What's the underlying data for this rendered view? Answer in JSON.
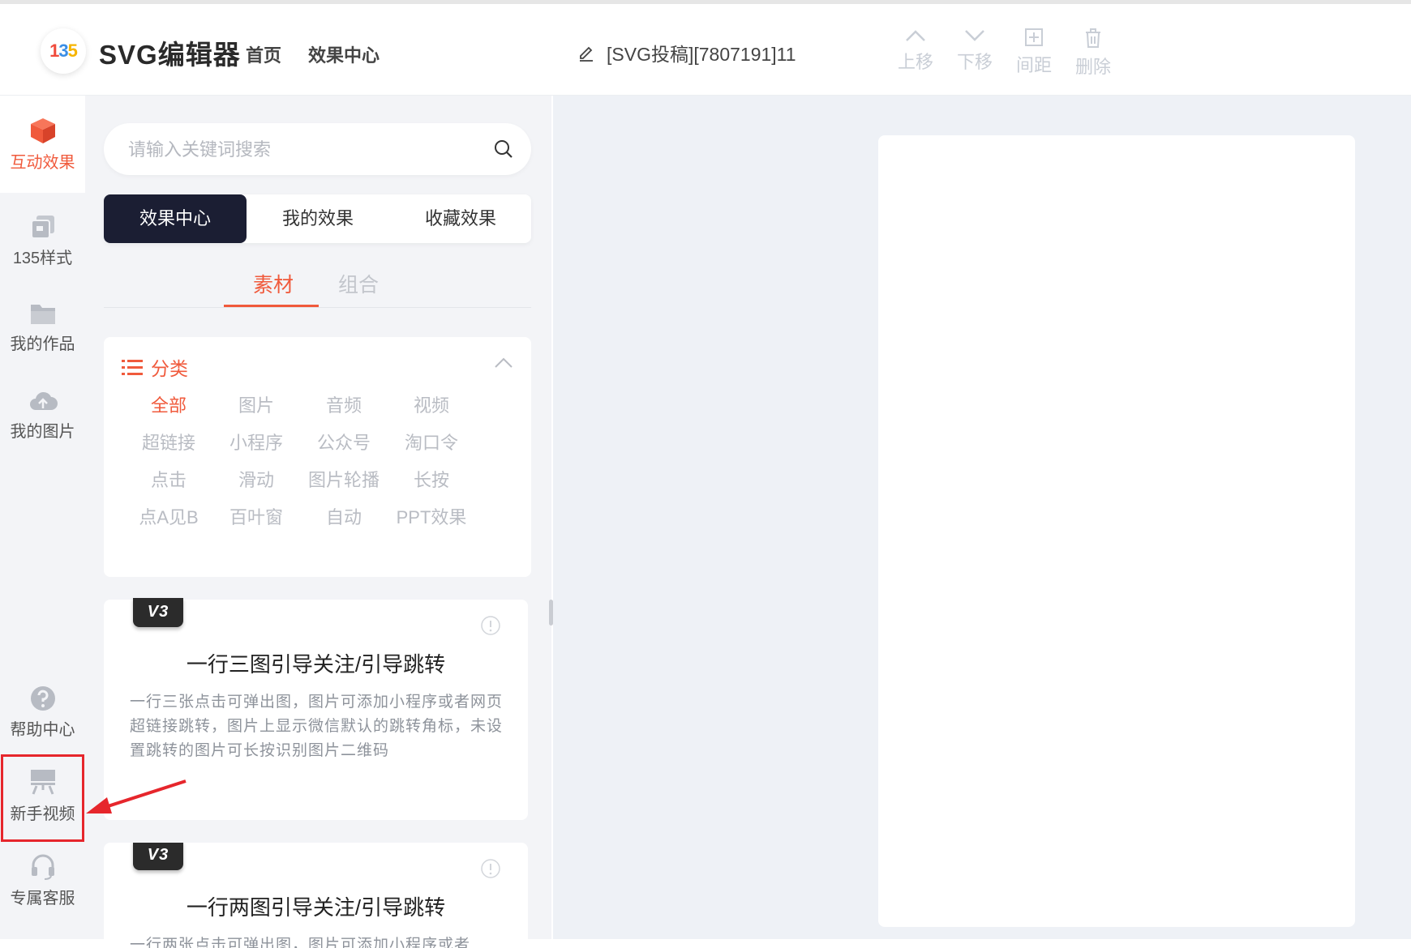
{
  "header": {
    "logo_text": "135",
    "app_name": "SVG编辑器",
    "nav": [
      "首页",
      "效果中心"
    ],
    "doc_title": "[SVG投稿][7807191]11",
    "tools": [
      {
        "label": "上移",
        "icon": "chevron-up-icon"
      },
      {
        "label": "下移",
        "icon": "chevron-down-icon"
      },
      {
        "label": "间距",
        "icon": "spacing-icon"
      },
      {
        "label": "删除",
        "icon": "trash-icon"
      }
    ]
  },
  "rail": {
    "items": [
      {
        "label": "互动效果",
        "icon": "cube-icon",
        "active": true
      },
      {
        "label": "135样式",
        "icon": "layers-icon"
      },
      {
        "label": "我的作品",
        "icon": "folder-icon"
      },
      {
        "label": "我的图片",
        "icon": "cloud-upload-icon"
      },
      {
        "label": "帮助中心",
        "icon": "help-icon"
      },
      {
        "label": "新手视频",
        "icon": "video-board-icon"
      },
      {
        "label": "专属客服",
        "icon": "headset-icon"
      }
    ],
    "accent": "#f05a3c",
    "highlight_color": "#e6262c"
  },
  "panel": {
    "search_placeholder": "请输入关键词搜索",
    "tabs": [
      "效果中心",
      "我的效果",
      "收藏效果"
    ],
    "subtabs": [
      "素材",
      "组合"
    ],
    "category_title": "分类",
    "categories": [
      "全部",
      "图片",
      "音频",
      "视频",
      "超链接",
      "小程序",
      "公众号",
      "淘口令",
      "点击",
      "滑动",
      "图片轮播",
      "长按",
      "点A见B",
      "百叶窗",
      "自动",
      "PPT效果"
    ],
    "cards": [
      {
        "badge": "V3",
        "title": "一行三图引导关注/引导跳转",
        "desc": "一行三张点击可弹出图，图片可添加小程序或者网页超链接跳转，图片上显示微信默认的跳转角标，未设置跳转的图片可长按识别图片二维码"
      },
      {
        "badge": "V3",
        "title": "一行两图引导关注/引导跳转",
        "desc": "一行两张点击可弹出图，图片可添加小程序或者"
      }
    ]
  }
}
